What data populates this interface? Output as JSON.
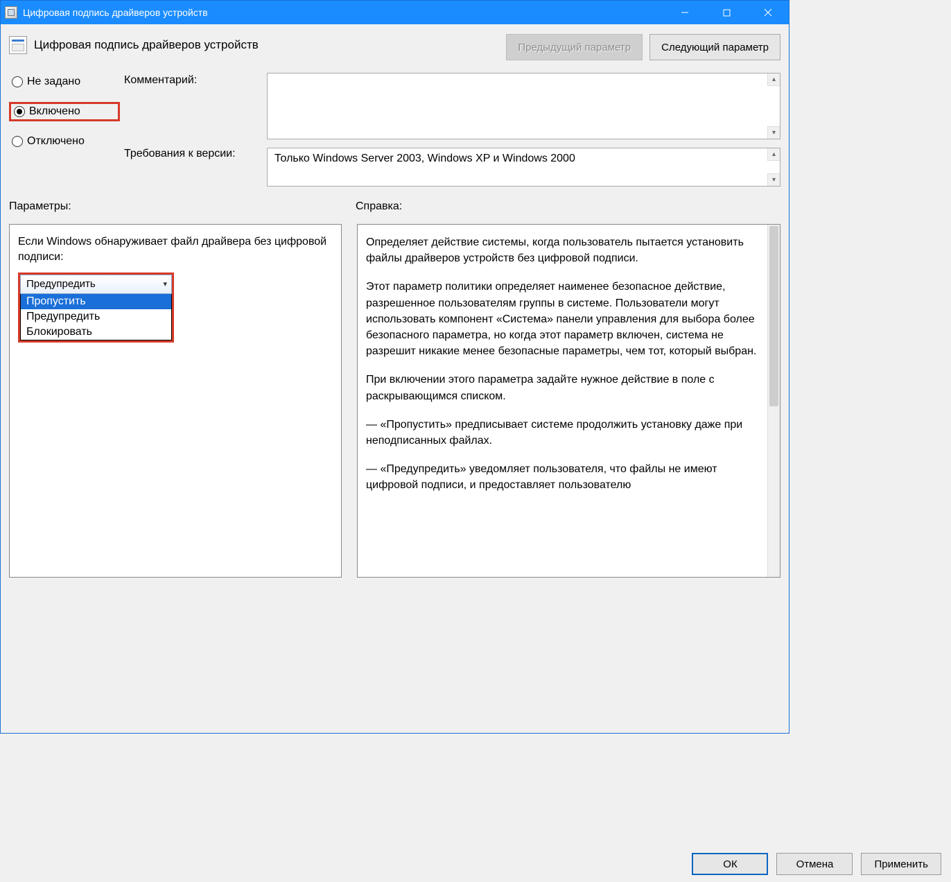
{
  "window": {
    "title": "Цифровая подпись драйверов устройств"
  },
  "header": {
    "title": "Цифровая подпись драйверов устройств",
    "prev": "Предыдущий параметр",
    "next": "Следующий параметр"
  },
  "state": {
    "not_configured": "Не задано",
    "enabled": "Включено",
    "disabled": "Отключено",
    "comment_label": "Комментарий:",
    "version_label": "Требования к версии:",
    "version_text": "Только Windows Server 2003, Windows XP и Windows 2000"
  },
  "sections": {
    "params_label": "Параметры:",
    "help_label": "Справка:"
  },
  "params": {
    "if_label": "Если Windows обнаруживает файл драйвера без цифровой подписи:",
    "combo_value": "Предупредить",
    "options": {
      "skip": "Пропустить",
      "warn": "Предупредить",
      "block": "Блокировать"
    }
  },
  "help": {
    "p1": "Определяет действие системы, когда пользователь пытается установить файлы драйверов устройств без цифровой подписи.",
    "p2": "Этот параметр политики определяет наименее безопасное действие, разрешенное пользователям группы в системе. Пользователи могут использовать компонент «Система» панели управления для выбора более безопасного параметра, но когда этот параметр включен, система не разрешит никакие менее безопасные параметры, чем тот, который выбран.",
    "p3": "При включении этого параметра задайте нужное действие в поле с раскрывающимся списком.",
    "p4": "— «Пропустить» предписывает системе продолжить установку даже при неподписанных файлах.",
    "p5": "— «Предупредить» уведомляет пользователя, что файлы не имеют цифровой подписи, и предоставляет пользователю"
  },
  "buttons": {
    "ok": "ОК",
    "cancel": "Отмена",
    "apply": "Применить"
  }
}
